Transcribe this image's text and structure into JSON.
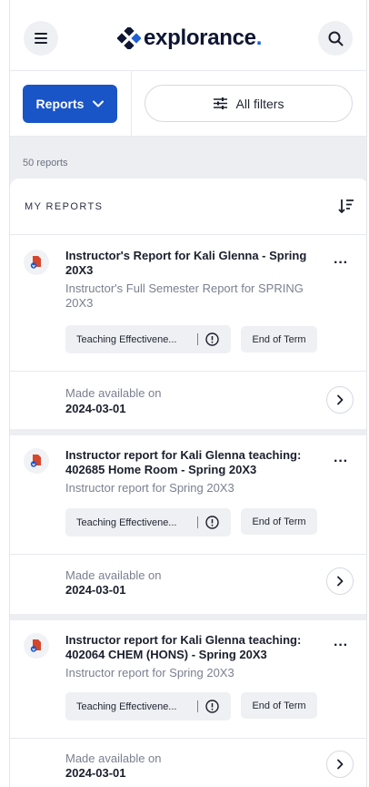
{
  "header": {
    "logo_text": "explorance",
    "logo_dot": ".",
    "menu_icon": "hamburger-icon",
    "search_icon": "search-icon"
  },
  "toolbar": {
    "reports_label": "Reports",
    "filters_label": "All filters"
  },
  "summary": {
    "count_text": "50 reports"
  },
  "panel": {
    "heading": "MY REPORTS",
    "sort_icon": "sort-icon"
  },
  "reports": [
    {
      "title": "Instructor's Report for Kali Glenna - Spring 20X3",
      "subtitle": "Instructor's Full Semester Report for SPRING 20X3",
      "survey_tag": "Teaching Effectivene...",
      "term_tag": "End of Term",
      "available_label": "Made available on",
      "available_date": "2024-03-01"
    },
    {
      "title": "Instructor report for Kali Glenna teaching: 402685 Home Room - Spring 20X3",
      "subtitle": "Instructor report for Spring 20X3",
      "survey_tag": "Teaching Effectivene...",
      "term_tag": "End of Term",
      "available_label": "Made available on",
      "available_date": "2024-03-01"
    },
    {
      "title": "Instructor report for Kali Glenna teaching: 402064 CHEM (HONS) - Spring 20X3",
      "subtitle": "Instructor report for Spring 20X3",
      "survey_tag": "Teaching Effectivene...",
      "term_tag": "End of Term",
      "available_label": "Made available on",
      "available_date": "2024-03-01"
    }
  ],
  "colors": {
    "primary": "#1a55c8",
    "logo_dark": "#0f1633",
    "file_icon_red": "#d6462c",
    "file_icon_blue": "#1a55c8"
  }
}
